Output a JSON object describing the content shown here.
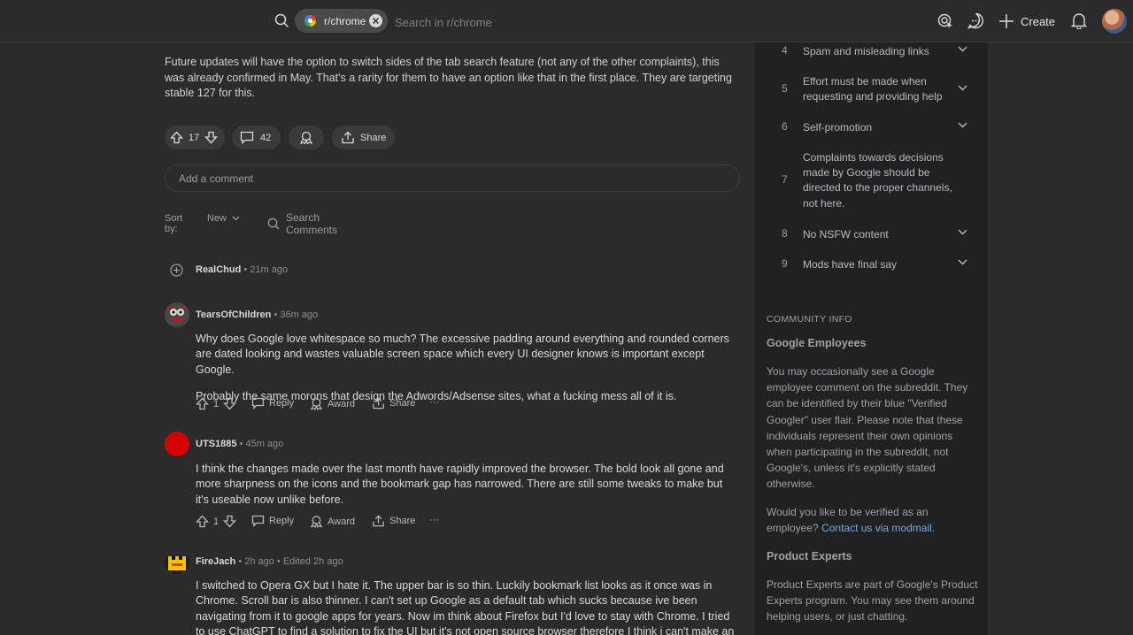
{
  "header": {
    "community_chip": "r/chrome",
    "search_placeholder": "Search in r/chrome",
    "create_label": "Create"
  },
  "post": {
    "body": "Future updates will have the option to switch sides of the tab search feature (not any of the other complaints), this was already confirmed in May. That's a rarity for them to have an option like that in the first place. They are targeting stable 127 for this.",
    "upvotes": "17",
    "comments": "42",
    "share_label": "Share"
  },
  "comment_box": {
    "placeholder": "Add a comment"
  },
  "sort": {
    "label": "Sort by:",
    "value": "New",
    "search_label": "Search Comments"
  },
  "comments": [
    {
      "author": "RealChud",
      "meta": "• 21m ago",
      "collapsed": true
    },
    {
      "author": "TearsOfChildren",
      "meta": "• 36m ago",
      "paragraphs": [
        "Why does Google love whitespace so much? The excessive padding around everything and rounded corners are dated looking and wastes valuable screen space which every UI designer knows is important except Google.",
        "Probably the same morons that design the Adwords/Adsense sites, what a fucking mess all of it is."
      ],
      "votes": "1",
      "reply": "Reply",
      "award": "Award",
      "share": "Share",
      "more": "···"
    },
    {
      "author": "UTS1885",
      "meta": "• 45m ago",
      "paragraphs": [
        "I think the changes made over the last month have rapidly improved the browser. The bold look all gone and more sharpness on the icons and the bookmark gap has narrowed. There are still some tweaks to make but it's useable now unlike before."
      ],
      "votes": "1",
      "reply": "Reply",
      "award": "Award",
      "share": "Share",
      "more": "···"
    },
    {
      "author": "FireJach",
      "meta": "• 2h ago • Edited 2h ago",
      "paragraphs": [
        "I switched to Opera GX but I hate it. The upper bar is so thin. Luckily bookmark list looks as it once was in Chrome. Scroll bar is also thinner. I can't set up Google as a default tab which sucks because ive been navigating from it to google apps for years. Now im think about Firefox but I'd love to stay with Chrome. I tried to use ChatGPT to find a solution to fix the UI but it's not open source browser therefore I think i can't make an extension to fix this shit."
      ]
    }
  ],
  "sidebar": {
    "rules": [
      {
        "num": "4",
        "text": "Spam and misleading links",
        "chevron": true
      },
      {
        "num": "5",
        "text": "Effort must be made when requesting and providing help",
        "chevron": true
      },
      {
        "num": "6",
        "text": "Self-promotion",
        "chevron": true
      },
      {
        "num": "7",
        "text": "Complaints towards decisions made by Google should be directed to the proper channels, not here.",
        "chevron": false
      },
      {
        "num": "8",
        "text": "No NSFW content",
        "chevron": true
      },
      {
        "num": "9",
        "text": "Mods have final say",
        "chevron": true
      }
    ],
    "community_info_label": "COMMUNITY INFO",
    "google_employees_title": "Google Employees",
    "google_employees_text": "You may occasionally see a Google employee comment on the subreddit. They can be identified by their blue \"Verified Googler\" user flair. Please note that these individuals represent their own opinions when participating in the subreddit, not Google's, unless it's explicitly stated otherwise.",
    "verify_text": "Would you like to be verified as an employee?",
    "verify_link": "Contact us via modmail.",
    "product_experts_title": "Product Experts",
    "product_experts_text": "Product Experts are part of Google's Product Experts program. You may see them around helping users, or just chatting."
  },
  "colors": {
    "background": "#2b2b2b",
    "sidebar": "#212121",
    "link": "#7aa9e0",
    "avatar_red": "#d40000"
  }
}
